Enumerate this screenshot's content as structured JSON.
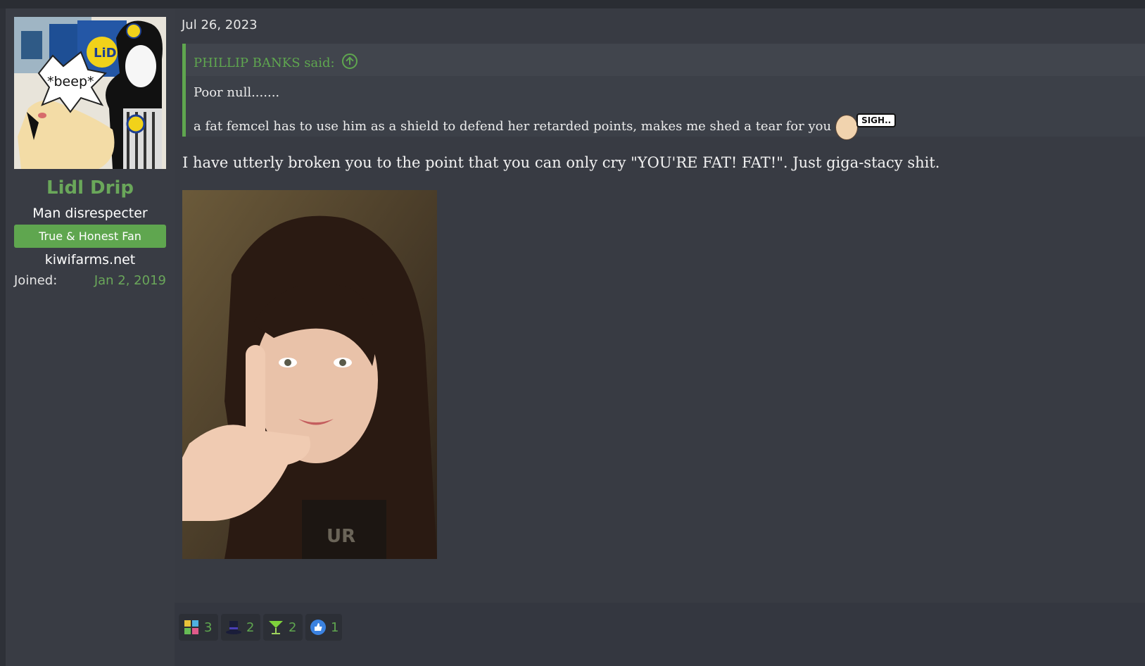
{
  "post": {
    "date": "Jul 26, 2023",
    "user": {
      "name": "Lidl Drip",
      "title": "Man disrespecter",
      "banner": "True & Honest Fan",
      "site": "kiwifarms.net",
      "joined_label": "Joined:",
      "joined_value": "Jan 2, 2019",
      "avatar_caption": "*beep*",
      "avatar_logo_text": "LiDL"
    },
    "quote": {
      "author": "PHILLIP BANKS said:",
      "line1": "Poor null.......",
      "line2": "a fat femcel has to use him as a shield to defend her retarded points, makes me shed a tear for you",
      "smilie_text": "SIGH.."
    },
    "body": "I have utterly broken you to the point that you can only cry \"YOU'RE FAT! FAT!\". Just giga-stacy shit.",
    "photo_shirt_text": "UR",
    "reactions": [
      {
        "icon": "puzzle-icon",
        "count": "3"
      },
      {
        "icon": "top-hat-icon",
        "count": "2"
      },
      {
        "icon": "cocktail-icon",
        "count": "2"
      },
      {
        "icon": "thumbs-up-icon",
        "count": "1"
      }
    ]
  },
  "colors": {
    "accent_green": "#5fa64f",
    "username_green": "#6aa75a",
    "background": "#383b43"
  }
}
